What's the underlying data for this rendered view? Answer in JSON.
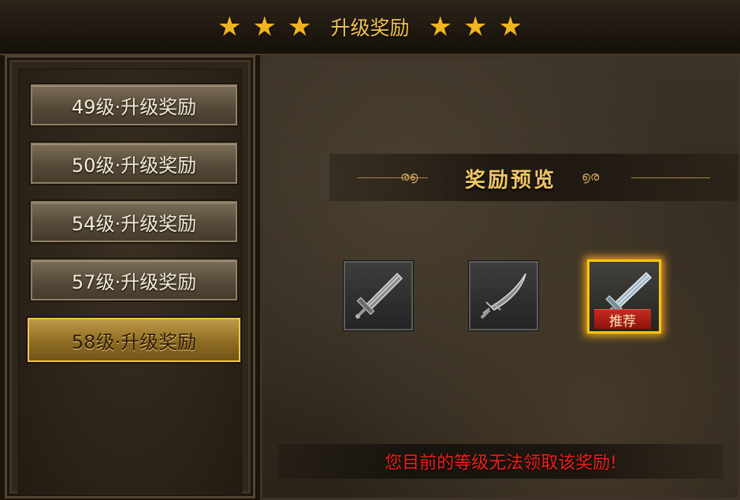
{
  "header": {
    "title": "升级奖励",
    "stars_left": [
      "★",
      "★",
      "★"
    ],
    "stars_right": [
      "★",
      "★",
      "★"
    ]
  },
  "level_list": [
    {
      "label": "49级·升级奖励",
      "selected": false
    },
    {
      "label": "50级·升级奖励",
      "selected": false
    },
    {
      "label": "54级·升级奖励",
      "selected": false
    },
    {
      "label": "57级·升级奖励",
      "selected": false
    },
    {
      "label": "58级·升级奖励",
      "selected": true
    }
  ],
  "preview": {
    "title": "奖励预览",
    "ornament_left": "ര൭",
    "ornament_right": "൭ര",
    "items": [
      {
        "icon": "greatsword-icon",
        "recommended": false
      },
      {
        "icon": "curved-blade-icon",
        "recommended": false
      },
      {
        "icon": "glowing-sword-icon",
        "recommended": true,
        "badge": "推荐"
      }
    ]
  },
  "status": {
    "warning": "您目前的等级无法领取该奖励!"
  },
  "colors": {
    "accent_gold": "#f2c253",
    "selected_border": "#f1c64e",
    "warning_red": "#ee1f1b",
    "badge_red": "#c42a20"
  }
}
